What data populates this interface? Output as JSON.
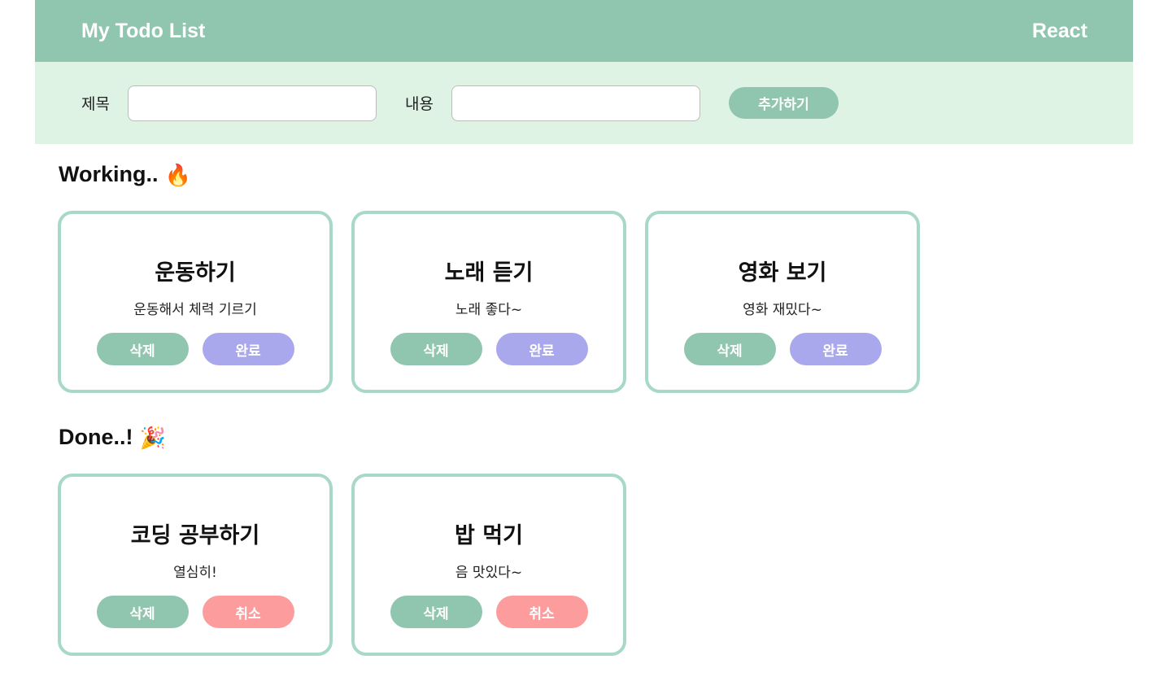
{
  "header": {
    "title": "My Todo List",
    "right_label": "React"
  },
  "form": {
    "title_label": "제목",
    "title_value": "",
    "content_label": "내용",
    "content_value": "",
    "add_label": "추가하기"
  },
  "working": {
    "title": "Working..",
    "emoji": "🔥",
    "items": [
      {
        "title": "운동하기",
        "body": "운동해서 체력 기르기",
        "delete_label": "삭제",
        "action_label": "완료"
      },
      {
        "title": "노래 듣기",
        "body": "노래 좋다~",
        "delete_label": "삭제",
        "action_label": "완료"
      },
      {
        "title": "영화 보기",
        "body": "영화 재밌다~",
        "delete_label": "삭제",
        "action_label": "완료"
      }
    ]
  },
  "done": {
    "title": "Done..!",
    "emoji": "🎉",
    "items": [
      {
        "title": "코딩 공부하기",
        "body": "열심히!",
        "delete_label": "삭제",
        "action_label": "취소"
      },
      {
        "title": "밥 먹기",
        "body": "음 맛있다~",
        "delete_label": "삭제",
        "action_label": "취소"
      }
    ]
  },
  "colors": {
    "header_bg": "#90c5b0",
    "form_bg": "#dff3e5",
    "card_border": "#a8d8c6",
    "delete_btn": "#90c5b0",
    "done_btn": "#aaa8ec",
    "cancel_btn": "#fd9c9c"
  }
}
